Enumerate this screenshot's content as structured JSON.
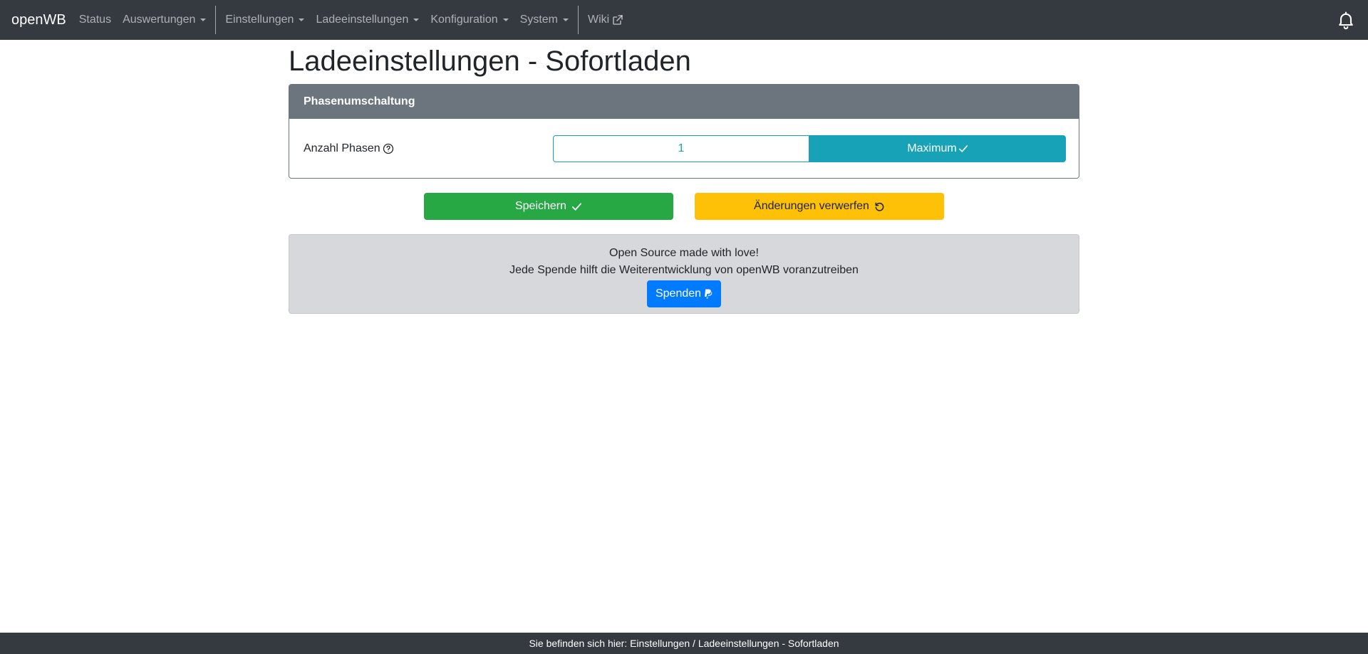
{
  "navbar": {
    "brand": "openWB",
    "items": [
      {
        "label": "Status"
      },
      {
        "label": "Auswertungen"
      },
      {
        "label": "Einstellungen"
      },
      {
        "label": "Ladeeinstellungen"
      },
      {
        "label": "Konfiguration"
      },
      {
        "label": "System"
      },
      {
        "label": "Wiki"
      }
    ],
    "icons": {
      "external": "external-link-icon",
      "bell": "bell-icon"
    }
  },
  "page": {
    "title": "Ladeeinstellungen - Sofortladen"
  },
  "card": {
    "header": "Phasenumschaltung",
    "field_label": "Anzahl Phasen",
    "options": [
      {
        "label": "1",
        "selected": false
      },
      {
        "label": "Maximum",
        "selected": true
      }
    ]
  },
  "actions": {
    "save_label": "Speichern",
    "discard_label": "Änderungen verwerfen"
  },
  "donate": {
    "line1": "Open Source made with love!",
    "line2": "Jede Spende hilft die Weiterentwicklung von openWB voranzutreiben",
    "button_label": "Spenden"
  },
  "footer": {
    "text": "Sie befinden sich hier: Einstellungen / Ladeeinstellungen - Sofortladen"
  },
  "colors": {
    "navbar": "#343a40",
    "card_header": "#6c757d",
    "info": "#17a2b8",
    "success": "#28a745",
    "warning": "#ffc107",
    "primary": "#007bff",
    "donate_bg": "#d6d8db"
  }
}
